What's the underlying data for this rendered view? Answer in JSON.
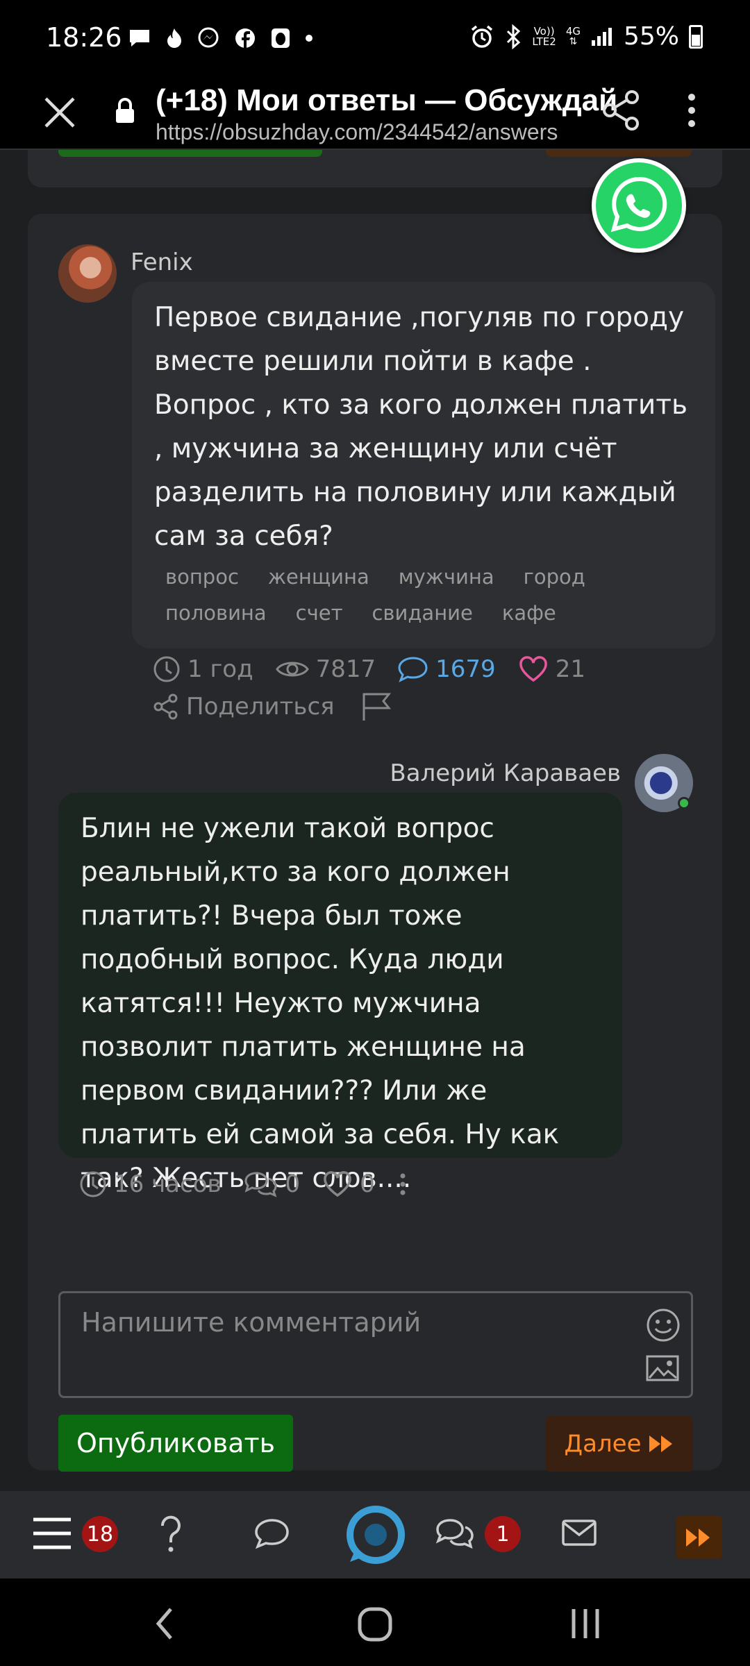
{
  "status_bar": {
    "time": "18:26",
    "battery": "55%",
    "network_top": "Vo))",
    "network_bottom": "LTE2",
    "net_gen": "4G"
  },
  "browser": {
    "title": "(+18) Мои ответы — Обсуждай",
    "url": "https://obsuzhday.com/2344542/answers"
  },
  "question": {
    "author": "Fenix",
    "text": "Первое свидание ,погуляв по городу вместе решили пойти в кафе . Вопрос , кто за кого должен платить , мужчина за женщину или счёт разделить на половину или каждый сам за себя?",
    "tags": [
      "вопрос",
      "женщина",
      "мужчина",
      "город",
      "половина",
      "счет",
      "свидание",
      "кафе"
    ],
    "age": "1 год",
    "views": "7817",
    "comments": "1679",
    "likes": "21",
    "share_label": "Поделиться"
  },
  "answer": {
    "author": "Валерий Караваев",
    "text": "Блин не ужели такой вопрос реальный,кто за кого должен платить?! Вчера был тоже подобный вопрос. Куда люди катятся!!! Неужто мужчина позволит платить женщине на первом свидании??? Или же платить ей самой за себя. Ну как так? Жесть нет слов....",
    "age": "16 часов",
    "comments": "0",
    "likes": "0"
  },
  "comment_form": {
    "placeholder": "Напишите комментарий",
    "publish_label": "Опубликовать",
    "next_label": "Далее"
  },
  "bottom_nav": {
    "menu_badge": "18",
    "messages_badge": "1"
  },
  "colors": {
    "background": "#1e1f21",
    "card": "#27282b",
    "question_bubble": "#2e2f32",
    "answer_bubble": "#1b2620",
    "publish": "#0c6b10",
    "next_text": "#ff8c2a",
    "comments_blue": "#5aa9e6",
    "likes_pink": "#e8579a",
    "badge_red": "#a31515",
    "whatsapp": "#25d366"
  }
}
